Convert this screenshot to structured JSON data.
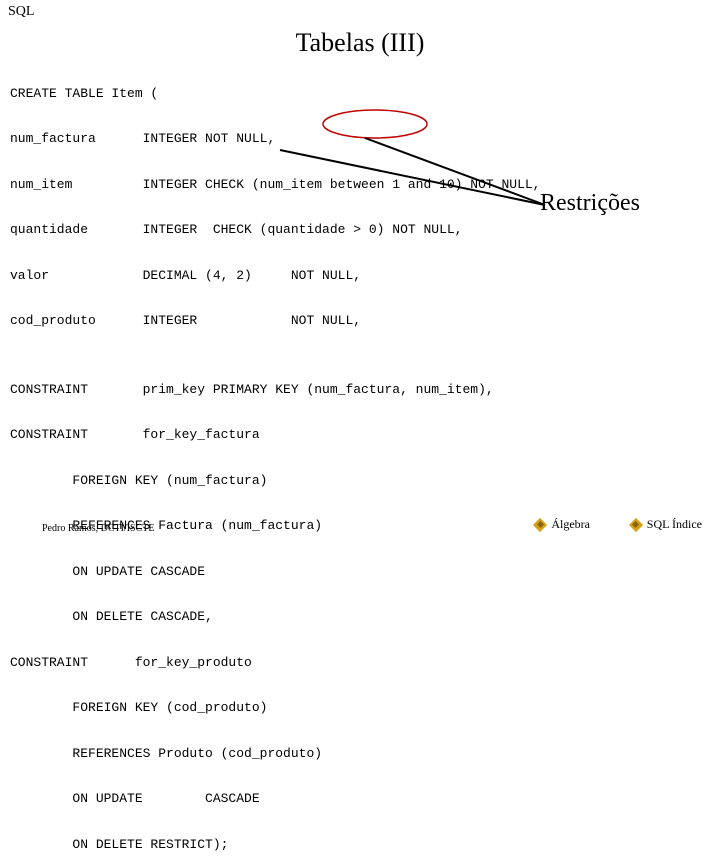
{
  "header": {
    "top_label": "SQL",
    "title": "Tabelas (III)"
  },
  "code": {
    "l01": "CREATE TABLE Item (",
    "l02": "num_factura      INTEGER NOT NULL,",
    "l03": "num_item         INTEGER CHECK (num_item between 1 and 10) NOT NULL,",
    "l04": "quantidade       INTEGER  CHECK (quantidade > 0) NOT NULL,",
    "l05": "valor            DECIMAL (4, 2)     NOT NULL,",
    "l06": "cod_produto      INTEGER            NOT NULL,",
    "l07": "CONSTRAINT       prim_key PRIMARY KEY (num_factura, num_item),",
    "l08": "CONSTRAINT       for_key_factura",
    "l09": "        FOREIGN KEY (num_factura)",
    "l10": "        REFERENCES Factura (num_factura)",
    "l11": "        ON UPDATE CASCADE",
    "l12": "        ON DELETE CASCADE,",
    "l13": "CONSTRAINT      for_key_produto",
    "l14": "        FOREIGN KEY (cod_produto)",
    "l15": "        REFERENCES Produto (cod_produto)",
    "l16": "        ON UPDATE        CASCADE",
    "l17": "        ON DELETE RESTRICT);"
  },
  "callout": {
    "label": "Restrições"
  },
  "footer": {
    "author": "Pedro Ramos, DCTI/ISCTE",
    "link_algebra": "Álgebra",
    "link_index": "SQL Índice"
  },
  "annotation": {
    "ellipse_stroke": "#c00000",
    "line_stroke": "#000000"
  }
}
